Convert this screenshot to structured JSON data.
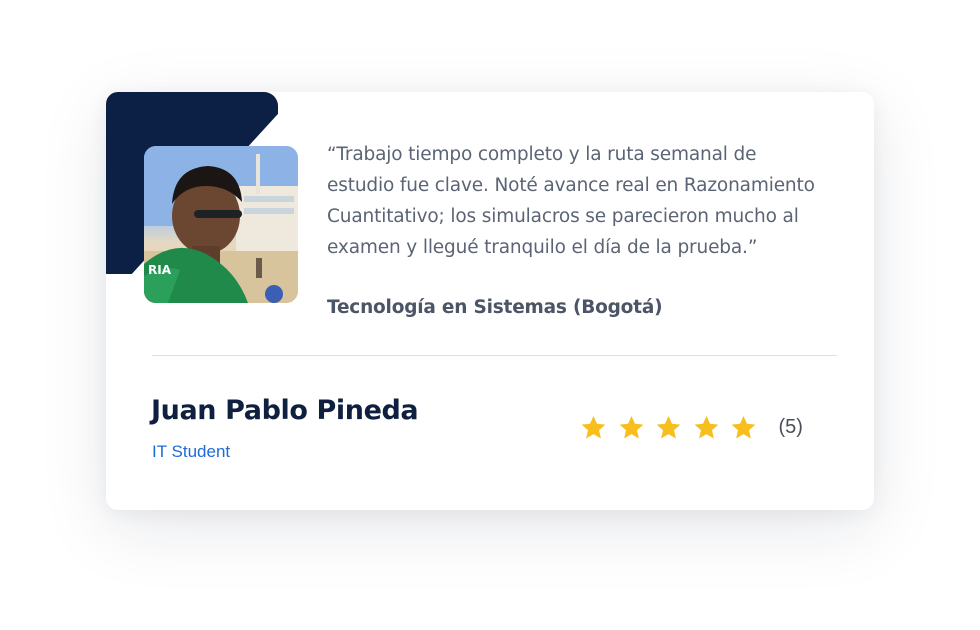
{
  "testimonial": {
    "quote": "“Trabajo tiempo completo y la ruta semanal de estudio fue clave. Noté avance real en Razonamiento Cuantitativo; los simulacros se parecieron mucho al examen y llegué tranquilo el día de la prueba.”",
    "program": "Tecnología en Sistemas (Bogotá)",
    "author_name": "Juan Pablo Pineda",
    "author_role": "IT Student",
    "avatar_icon": "student-photo",
    "rating": {
      "stars": 5,
      "max_stars": 5,
      "count_label": "(5)",
      "star_icon": "star-icon",
      "star_color": "#f7bf1d"
    }
  },
  "colors": {
    "accent": "#0c1f44",
    "role_link": "#1f6bd6",
    "quote_text": "#5b6475",
    "name_text": "#0f1f3f"
  }
}
